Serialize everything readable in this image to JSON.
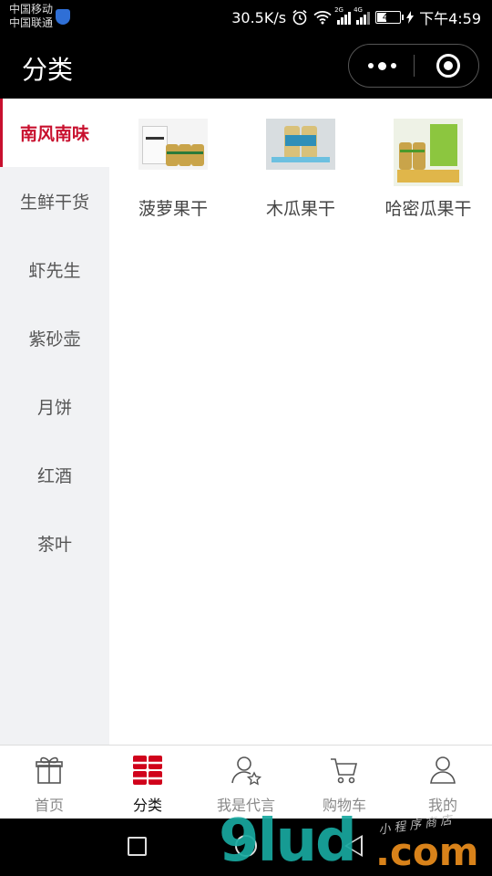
{
  "status_bar": {
    "carrier_1": "中国移动",
    "carrier_2": "中国联通",
    "net_speed": "30.5K/s",
    "signal_1_tag": "2G",
    "signal_2_tag": "4G",
    "battery": "40",
    "time": "下午4:59"
  },
  "header": {
    "title": "分类"
  },
  "colors": {
    "accent": "#c8102e",
    "sidebar_bg": "#f1f2f4",
    "header_bg": "#000000"
  },
  "sidebar": {
    "items": [
      {
        "label": "南风南味",
        "active": true
      },
      {
        "label": "生鲜干货",
        "active": false
      },
      {
        "label": "虾先生",
        "active": false
      },
      {
        "label": "紫砂壶",
        "active": false
      },
      {
        "label": "月饼",
        "active": false
      },
      {
        "label": "红酒",
        "active": false
      },
      {
        "label": "茶叶",
        "active": false
      }
    ]
  },
  "products": [
    {
      "name": "菠萝果干",
      "thumb_icon": "product-photo-gift-box"
    },
    {
      "name": "木瓜果干",
      "thumb_icon": "product-photo-cans"
    },
    {
      "name": "哈密瓜果干",
      "thumb_icon": "product-photo-gift-bag"
    }
  ],
  "tabbar": {
    "tabs": [
      {
        "label": "首页",
        "icon": "gift-icon",
        "active": false
      },
      {
        "label": "分类",
        "icon": "grid-icon",
        "active": true
      },
      {
        "label": "我是代言",
        "icon": "user-star-icon",
        "active": false
      },
      {
        "label": "购物车",
        "icon": "cart-icon",
        "active": false
      },
      {
        "label": "我的",
        "icon": "person-icon",
        "active": false
      }
    ]
  },
  "watermark": {
    "main": "9lud",
    "suffix": ".com",
    "tagline": "小程序商店"
  }
}
